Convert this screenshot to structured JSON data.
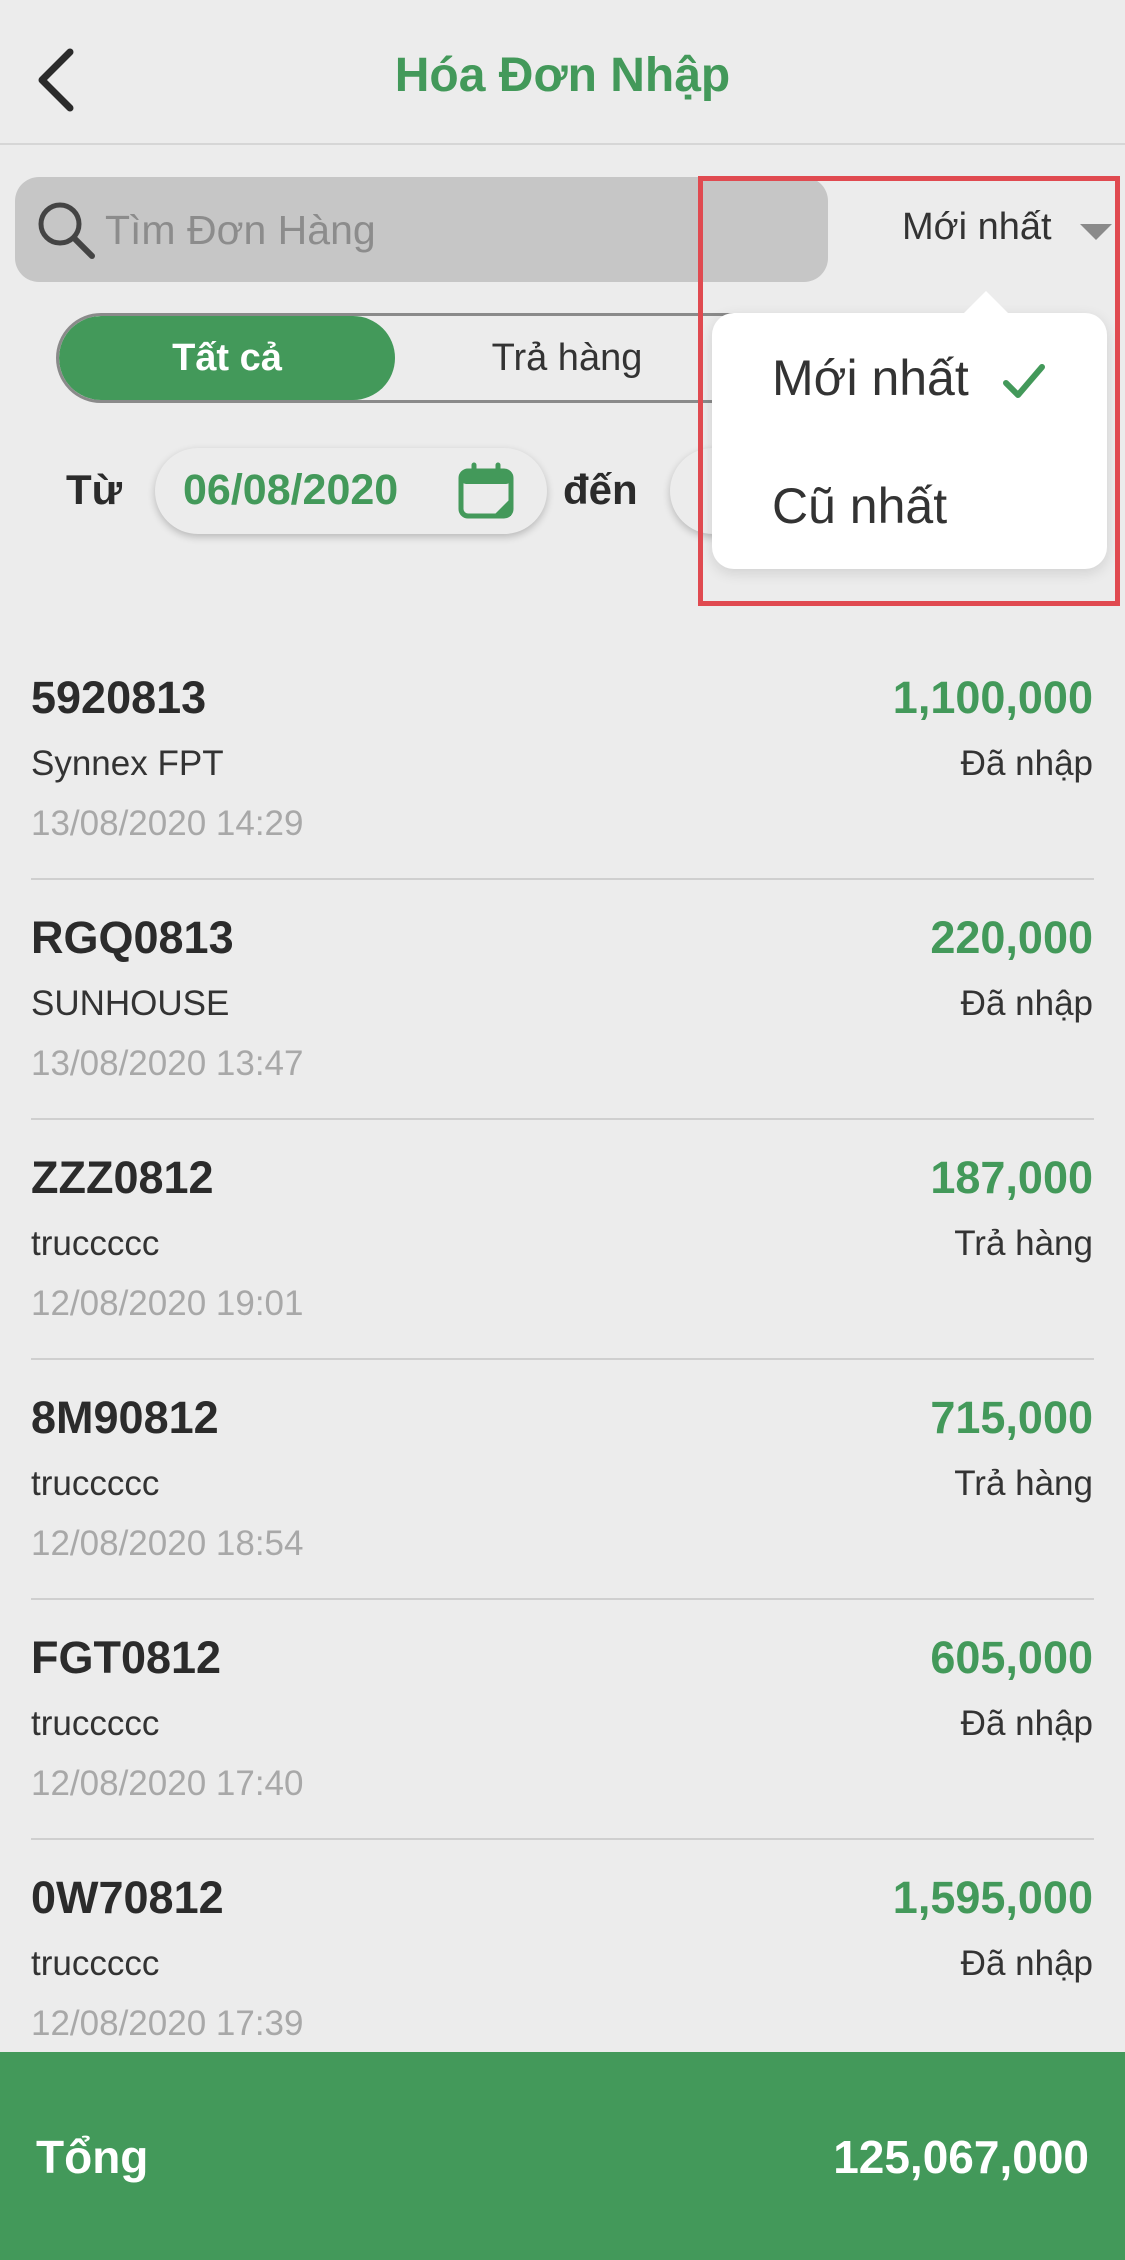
{
  "header": {
    "title": "Hóa Đơn Nhập",
    "back_icon": "chevron-left-icon"
  },
  "search": {
    "placeholder": "Tìm Đơn Hàng",
    "value": ""
  },
  "sort": {
    "selected": "Mới nhất",
    "options": [
      {
        "label": "Mới nhất",
        "checked": true
      },
      {
        "label": "Cũ nhất",
        "checked": false
      }
    ]
  },
  "tabs": [
    {
      "label": "Tất cả",
      "active": true
    },
    {
      "label": "Trả hàng",
      "active": false
    }
  ],
  "date_range": {
    "from_label": "Từ",
    "from_value": "06/08/2020",
    "to_label": "đến"
  },
  "orders": [
    {
      "code": "5920813",
      "supplier": "Synnex FPT",
      "time": "13/08/2020 14:29",
      "amount": "1,100,000",
      "status": "Đã nhập"
    },
    {
      "code": "RGQ0813",
      "supplier": "SUNHOUSE",
      "time": "13/08/2020 13:47",
      "amount": "220,000",
      "status": "Đã nhập"
    },
    {
      "code": "ZZZ0812",
      "supplier": "truccccc",
      "time": "12/08/2020 19:01",
      "amount": "187,000",
      "status": "Trả hàng"
    },
    {
      "code": "8M90812",
      "supplier": "truccccc",
      "time": "12/08/2020 18:54",
      "amount": "715,000",
      "status": "Trả hàng"
    },
    {
      "code": "FGT0812",
      "supplier": "truccccc",
      "time": "12/08/2020 17:40",
      "amount": "605,000",
      "status": "Đã nhập"
    },
    {
      "code": "0W70812",
      "supplier": "truccccc",
      "time": "12/08/2020 17:39",
      "amount": "1,595,000",
      "status": "Đã nhập"
    }
  ],
  "footer": {
    "label": "Tổng",
    "total": "125,067,000"
  },
  "colors": {
    "accent": "#43995a",
    "highlight": "#e04a50",
    "background": "#ececec"
  }
}
